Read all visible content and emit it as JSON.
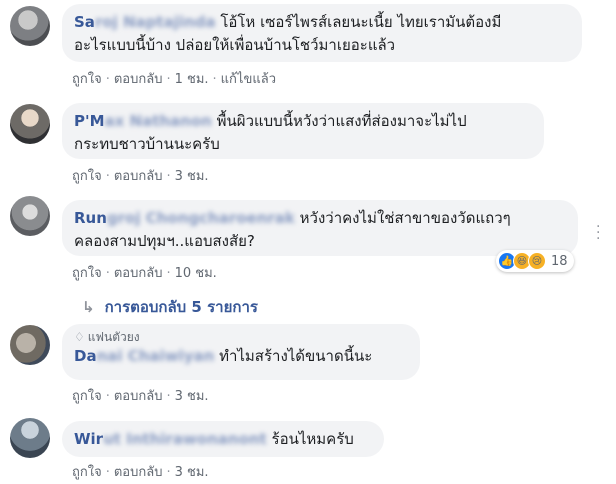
{
  "comments": [
    {
      "author_prefix": "Sa",
      "author_hidden": "roj Naptajinda",
      "text_line1": "โอ้โห เซอร์ไพรส์เลยนะเนี้ย ไทยเรามันต้องมี",
      "text_line2": "อะไรแบบนี้บ้าง ปล่อยให้เพื่อนบ้านโชว์มาเยอะแล้ว",
      "like": "ถูกใจ",
      "reply": "ตอบกลับ",
      "time": "1 ชม.",
      "edited": "แก้ไขแล้ว"
    },
    {
      "author_prefix": "P'M",
      "author_hidden": "ax Nathanon",
      "text_line1": "พื้นผิวแบบนี้หวังว่าแสงที่ส่องมาจะไม่ไป",
      "text_line2": "กระทบชาวบ้านนะครับ",
      "like": "ถูกใจ",
      "reply": "ตอบกลับ",
      "time": "3 ชม."
    },
    {
      "author_prefix": "Run",
      "author_hidden": "groj Chongcharoenrak",
      "text_line1": "หวังว่าคงไม่ใช่สาขาของวัดแถวๆ",
      "text_line2": "คลองสามปทุมฯ..แอบสงสัย?",
      "like": "ถูกใจ",
      "reply": "ตอบกลับ",
      "time": "10 ชม.",
      "reaction_count": "18"
    },
    {
      "fan_label": "แฟนตัวยง",
      "author_prefix": "Da",
      "author_hidden": "nai Chaiwiyan",
      "text_line1": "ทำไมสร้างได้ขนาดนี้นะ",
      "like": "ถูกใจ",
      "reply": "ตอบกลับ",
      "time": "3 ชม."
    },
    {
      "author_prefix": "Wir",
      "author_hidden": "ut Inthirawonanont",
      "text_line1": "ร้อนไหมครับ",
      "like": "ถูกใจ",
      "reply": "ตอบกลับ",
      "time": "3 ชม."
    }
  ],
  "replies_label": "การตอบกลับ 5 รายการ",
  "icons": {
    "reply_arrow": "↳",
    "fan_badge": "diamond-icon",
    "reactions": [
      "like-icon",
      "haha-icon",
      "sad-icon"
    ]
  },
  "colors": {
    "author": "#385898",
    "bubble_bg": "#f2f3f5",
    "meta_text": "#606770",
    "like_blue": "#1877f2"
  }
}
